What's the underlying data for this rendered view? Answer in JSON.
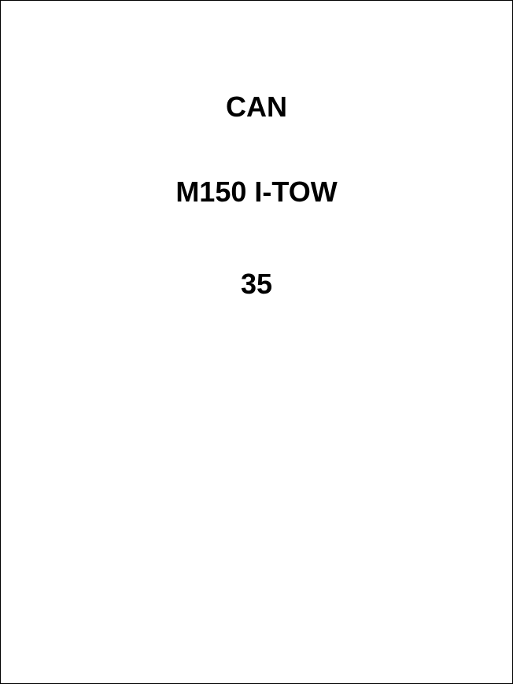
{
  "document": {
    "lines": [
      "CAN",
      "M150 I-TOW",
      "35"
    ],
    "colors": {
      "background": "#ffffff",
      "text": "#000000",
      "border": "#000000"
    }
  }
}
